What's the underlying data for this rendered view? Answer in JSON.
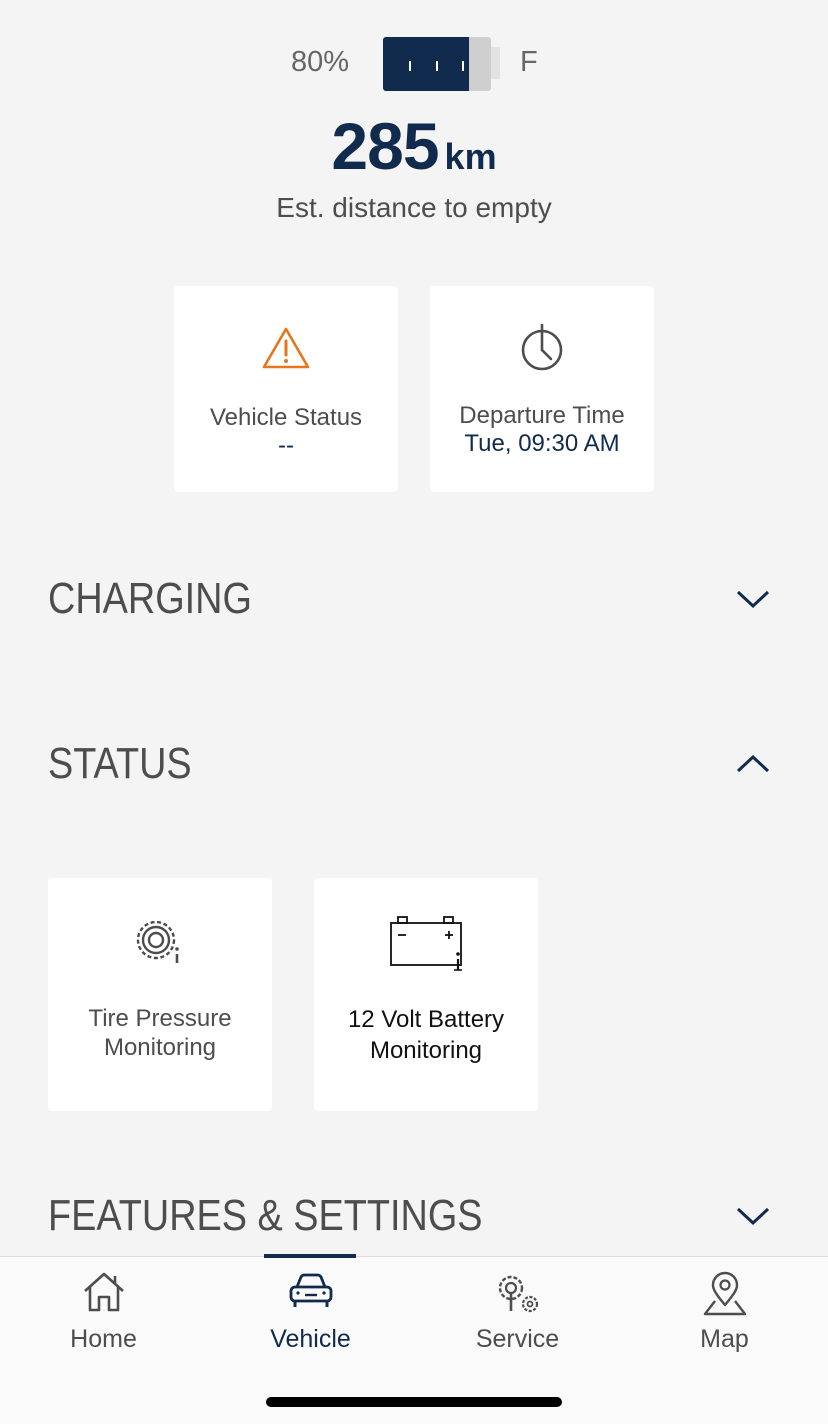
{
  "battery": {
    "percent_label": "80%",
    "level": 0.8,
    "full_label": "F",
    "range_value": "285",
    "range_unit": "km",
    "range_caption": "Est. distance to empty"
  },
  "cards": {
    "vehicle_status": {
      "label": "Vehicle Status",
      "value": "--",
      "icon": "warning-triangle-icon"
    },
    "departure_time": {
      "label": "Departure Time",
      "value": "Tue, 09:30 AM",
      "icon": "clock-icon"
    }
  },
  "sections": {
    "charging": {
      "title": "CHARGING",
      "expanded": false
    },
    "status": {
      "title": "STATUS",
      "expanded": true
    },
    "features": {
      "title": "FEATURES & SETTINGS",
      "expanded": false
    }
  },
  "status_tiles": {
    "tire": {
      "line1": "Tire Pressure",
      "line2": "Monitoring",
      "icon": "tire-pressure-icon"
    },
    "battery12v": {
      "line1": "12 Volt Battery",
      "line2": "Monitoring",
      "icon": "car-battery-icon"
    }
  },
  "nav": {
    "items": [
      {
        "label": "Home",
        "icon": "home-icon"
      },
      {
        "label": "Vehicle",
        "icon": "car-icon",
        "active": true
      },
      {
        "label": "Service",
        "icon": "service-gear-icon"
      },
      {
        "label": "Map",
        "icon": "map-pin-icon"
      }
    ]
  },
  "colors": {
    "brand_navy": "#102b4e",
    "warning_orange": "#e8751a",
    "background": "#f4f4f4"
  }
}
